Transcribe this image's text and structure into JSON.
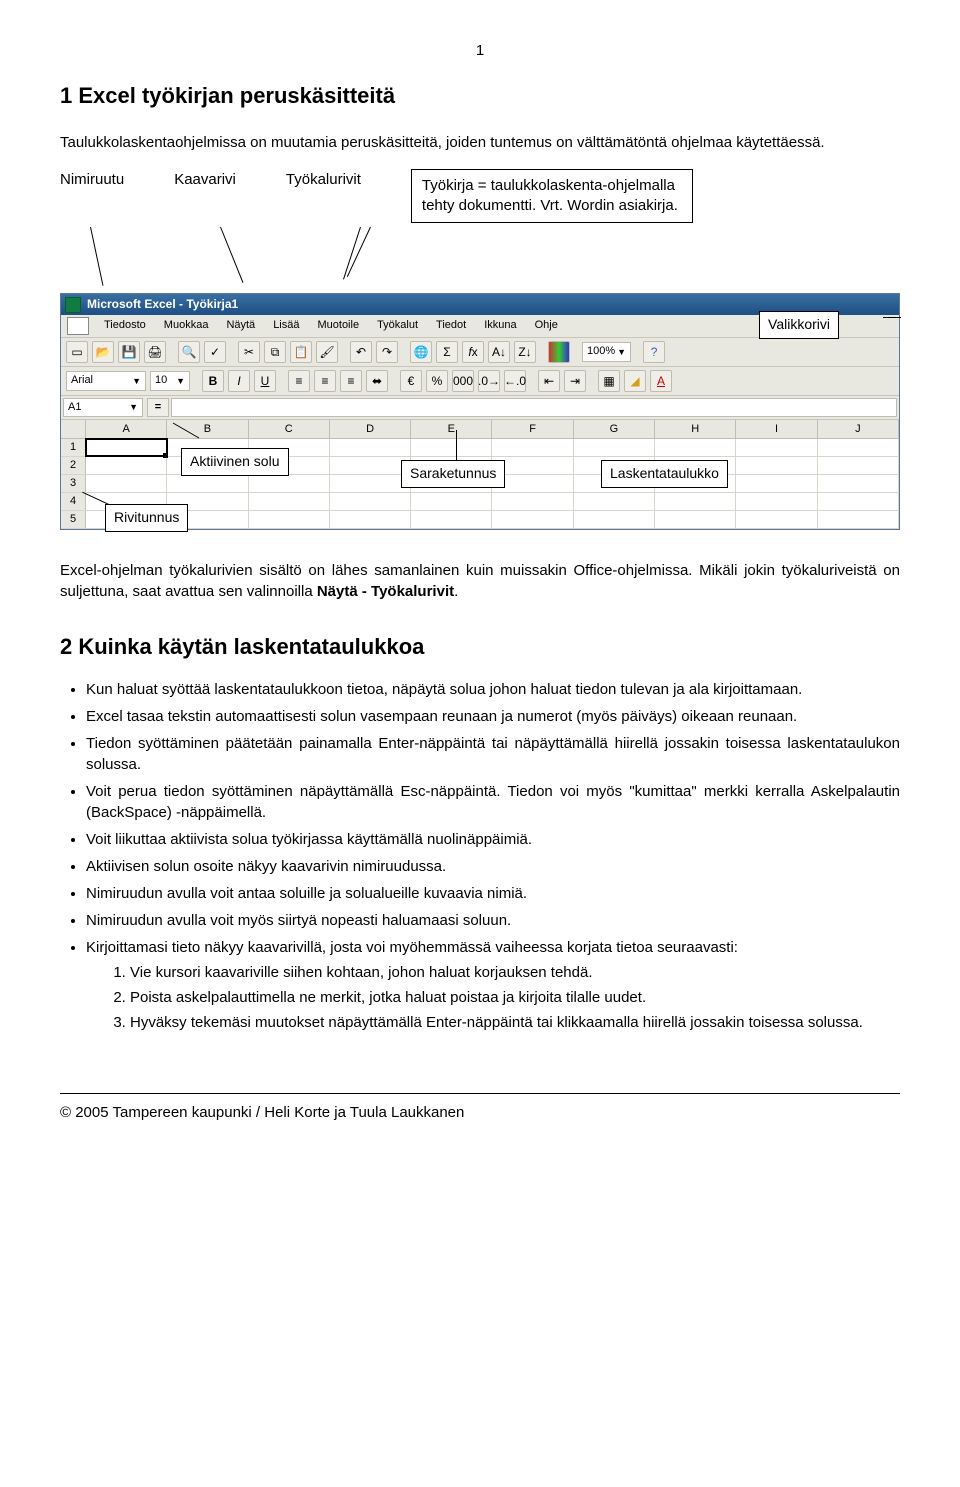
{
  "page_number": "1",
  "heading1": "1 Excel työkirjan peruskäsitteitä",
  "intro": "Taulukkolaskentaohjelmissa on muutamia peruskäsitteitä, joiden tuntemus on välttämätöntä ohjelmaa käytettäessä.",
  "terms": {
    "nimiruutu": "Nimiruutu",
    "kaavarivi": "Kaavarivi",
    "tyokalurivit": "Työkalurivit"
  },
  "infobox": "Työkirja = taulukkolaskenta-ohjelmalla tehty dokumentti. Vrt. Wordin asiakirja.",
  "screenshot": {
    "titlebar": "Microsoft Excel - Työkirja1",
    "menu": [
      "Tiedosto",
      "Muokkaa",
      "Näytä",
      "Lisää",
      "Muotoile",
      "Työkalut",
      "Tiedot",
      "Ikkuna",
      "Ohje"
    ],
    "zoom": "100%",
    "font_name": "Arial",
    "font_size": "10",
    "name_box": "A1",
    "columns": [
      "A",
      "B",
      "C",
      "D",
      "E",
      "F",
      "G",
      "H",
      "I",
      "J"
    ],
    "rows": [
      "1",
      "2",
      "3",
      "4",
      "5"
    ]
  },
  "callouts": {
    "valikkorivi": "Valikkorivi",
    "aktiivinen": "Aktiivinen solu",
    "saraketunnus": "Saraketunnus",
    "laskentataulukko": "Laskentataulukko",
    "rivitunnus": "Rivitunnus"
  },
  "para2_a": "Excel-ohjelman työkalurivien sisältö on lähes samanlainen kuin muissakin Office-ohjelmissa. Mikäli jokin työkaluriveistä on suljettuna, saat avattua sen valinnoilla ",
  "para2_b": "Näytä - Työkalurivit",
  "para2_c": ".",
  "heading2": "2 Kuinka käytän laskentataulukkoa",
  "bullets": [
    "Kun haluat syöttää laskentataulukkoon tietoa, näpäytä solua johon haluat tiedon tulevan ja ala kirjoittamaan.",
    "Excel tasaa tekstin automaattisesti solun vasempaan reunaan ja numerot (myös päiväys) oikeaan reunaan.",
    "Tiedon syöttäminen päätetään painamalla Enter-näppäintä tai näpäyttämällä hiirellä jossakin toisessa laskentataulukon solussa.",
    "Voit perua tiedon syöttäminen näpäyttämällä Esc-näppäintä. Tiedon voi myös \"kumittaa\" merkki kerralla Askelpalautin (BackSpace) -näppäimellä.",
    "Voit liikuttaa aktiivista solua työkirjassa käyttämällä nuolinäppäimiä.",
    "Aktiivisen solun osoite näkyy kaavarivin nimiruudussa.",
    "Nimiruudun avulla voit antaa soluille ja solualueille kuvaavia nimiä.",
    "Nimiruudun avulla voit myös siirtyä nopeasti haluamaasi soluun.",
    "Kirjoittamasi tieto näkyy kaavarivillä, josta voi myöhemmässä vaiheessa korjata tietoa seuraavasti:"
  ],
  "numlist": [
    "Vie kursori kaavariville siihen kohtaan, johon haluat korjauksen tehdä.",
    "Poista askelpalauttimella ne merkit, jotka haluat poistaa ja kirjoita tilalle uudet.",
    "Hyväksy tekemäsi muutokset näpäyttämällä Enter-näppäintä tai klikkaamalla hiirellä jossakin toisessa solussa."
  ],
  "footer": "© 2005 Tampereen kaupunki / Heli Korte ja Tuula Laukkanen"
}
